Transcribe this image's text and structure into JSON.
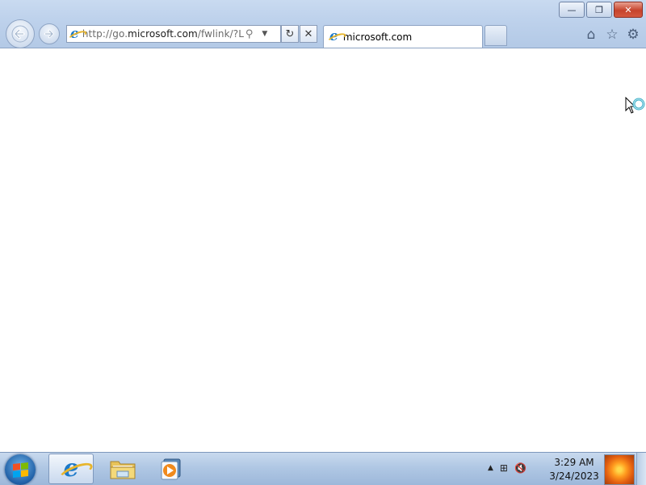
{
  "window": {
    "minimize_glyph": "—",
    "restore_glyph": "❐",
    "close_glyph": "✕"
  },
  "nav": {
    "back_icon": "back-arrow-icon",
    "forward_icon": "forward-arrow-icon"
  },
  "address_bar": {
    "url_prefix": "http://go.",
    "url_domain": "microsoft.com",
    "url_suffix": "/fwlink/?LinkI",
    "search_glyph": "⚲",
    "dropdown_glyph": "▼",
    "refresh_glyph": "↻",
    "stop_glyph": "✕"
  },
  "tabs": [
    {
      "label": "microsoft.com",
      "active": true
    }
  ],
  "toolbar": {
    "home_glyph": "⌂",
    "favorites_glyph": "☆",
    "tools_glyph": "⚙"
  },
  "taskbar": {
    "pinned": [
      "internet-explorer",
      "windows-explorer",
      "windows-media-player"
    ],
    "tray": {
      "show_hidden_glyph": "▲",
      "network_glyph": "⊞",
      "volume_glyph": "🔇"
    },
    "clock": {
      "time": "3:29 AM",
      "date": "3/24/2023"
    }
  },
  "colors": {
    "chrome_bg": "#bed2ec",
    "close_button": "#c6432c",
    "taskbar_bg": "#aec6e3",
    "ie_blue": "#1c79c9"
  }
}
